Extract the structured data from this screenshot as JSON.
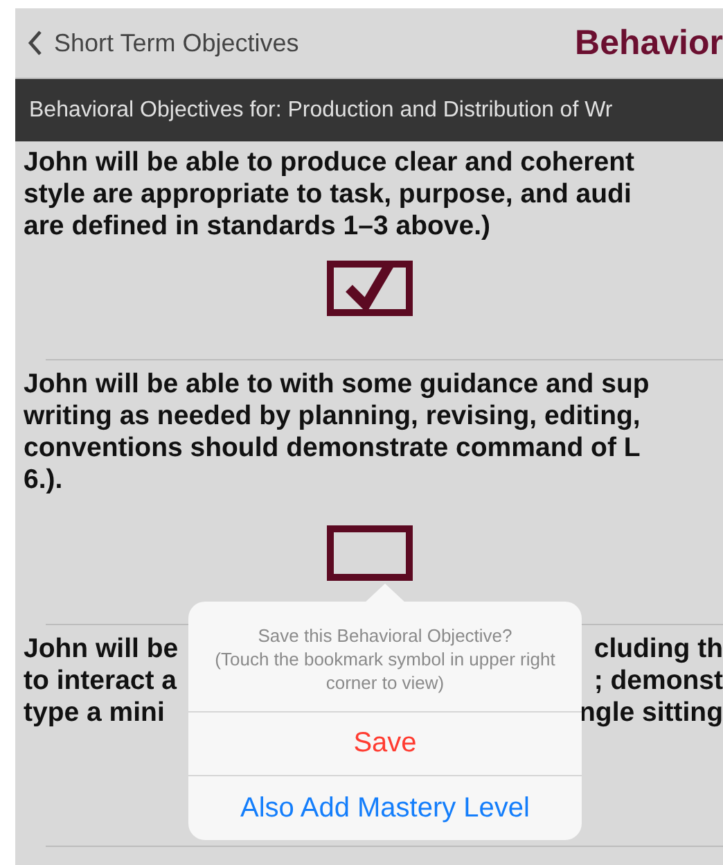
{
  "nav": {
    "back_label": "Short Term Objectives",
    "title": "Behavior"
  },
  "subheader": "Behavioral Objectives for: Production and Distribution of Wr",
  "objectives": [
    {
      "lines": [
        "John will be able to produce clear and coherent",
        "style are appropriate to task, purpose, and audi",
        "are defined in standards 1–3 above.)"
      ],
      "checked": true
    },
    {
      "lines": [
        "John will be able to with some guidance and sup",
        "writing as needed by planning, revising, editing,",
        "conventions should demonstrate command of L",
        "6.)."
      ],
      "checked": false
    },
    {
      "lines": [
        [
          "John will be",
          "cluding th"
        ],
        [
          "to interact a",
          "; demonst"
        ],
        [
          "type a mini",
          "ngle sitting"
        ]
      ]
    }
  ],
  "popover": {
    "title": "Save this Behavioral Objective?",
    "hint": "(Touch the bookmark symbol in upper right corner to view)",
    "actions": [
      {
        "label": "Save",
        "kind": "destructive"
      },
      {
        "label": "Also Add Mastery Level",
        "kind": "default"
      }
    ]
  }
}
